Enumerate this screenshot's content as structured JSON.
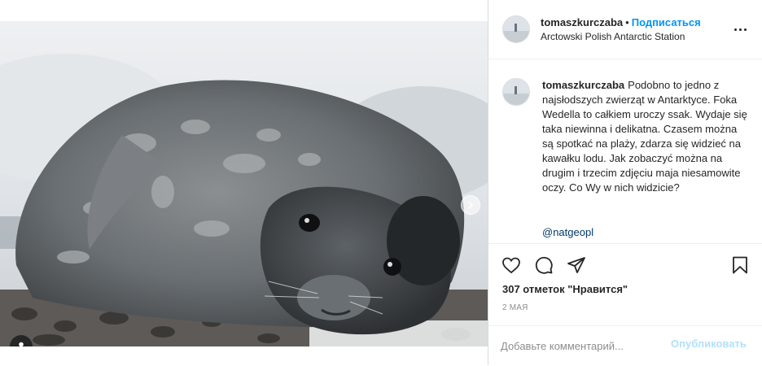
{
  "post": {
    "header": {
      "username": "tomaszkurczaba",
      "separator": "•",
      "follow_label": "Подписаться",
      "location": "Arctowski Polish Antarctic Station",
      "more_icon": "more-horizontal-icon"
    },
    "caption": {
      "username": "tomaszkurczaba",
      "text": "Podobno to jedno z najsłodszych zwierząt w Antarktyce. Foka Wedella to całkiem uroczy ssak. Wydaje się taka niewinna i delikatna. Czasem można są spotkać na plaży, zdarza się widzieć na kawałku lodu. Jak zobaczyć można na drugim i trzecim zdjęciu maja niesamowite oczy. Co Wy w nich widzicie?",
      "mention": "@natgeopl"
    },
    "actions": {
      "like_icon": "heart-icon",
      "comment_icon": "comment-icon",
      "share_icon": "share-icon",
      "save_icon": "bookmark-icon"
    },
    "likes_text": "307 отметок \"Нравится\"",
    "date": "2 МАЯ",
    "comment": {
      "placeholder": "Добавьте комментарий...",
      "value": "",
      "post_label": "Опубликовать"
    },
    "media": {
      "next_icon": "chevron-right-icon",
      "tag_icon": "user-tag-icon"
    },
    "colors": {
      "link_blue": "#0095f6",
      "mention_blue": "#00376b",
      "post_disabled": "#b2dffc",
      "meta_gray": "#8e8e8e"
    }
  }
}
